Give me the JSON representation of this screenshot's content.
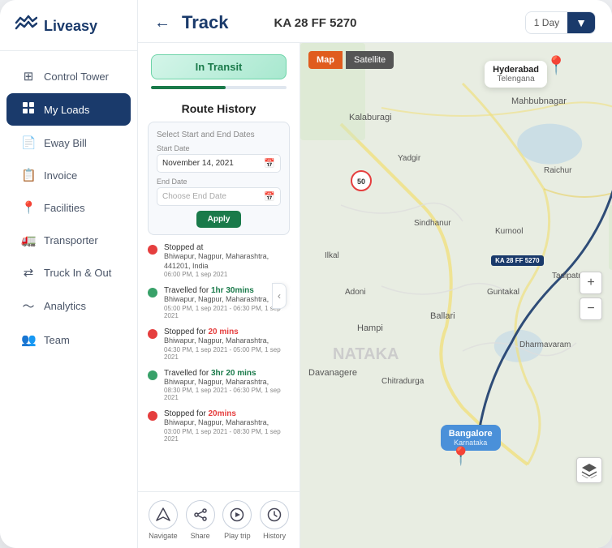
{
  "app": {
    "logo_text": "Liveasy",
    "logo_icon": "⋀⋀"
  },
  "sidebar": {
    "items": [
      {
        "id": "control-tower",
        "label": "Control Tower",
        "icon": "⊞",
        "active": false
      },
      {
        "id": "my-loads",
        "label": "My Loads",
        "icon": "📦",
        "active": true
      },
      {
        "id": "eway-bill",
        "label": "Eway Bill",
        "icon": "📄",
        "active": false
      },
      {
        "id": "invoice",
        "label": "Invoice",
        "icon": "📋",
        "active": false
      },
      {
        "id": "facilities",
        "label": "Facilities",
        "icon": "📍",
        "active": false
      },
      {
        "id": "transporter",
        "label": "Transporter",
        "icon": "🚛",
        "active": false
      },
      {
        "id": "truck-in-out",
        "label": "Truck In & Out",
        "icon": "🔄",
        "active": false
      },
      {
        "id": "analytics",
        "label": "Analytics",
        "icon": "📈",
        "active": false
      },
      {
        "id": "team",
        "label": "Team",
        "icon": "👥",
        "active": false
      }
    ]
  },
  "header": {
    "back_label": "←",
    "title": "Track",
    "vehicle_id": "KA 28 FF 5270",
    "day_selector": {
      "label": "1 Day",
      "dropdown_icon": "▼"
    }
  },
  "transit_badge": "In Transit",
  "progress_percent": 55,
  "route_history": {
    "title": "Route History",
    "date_selector": {
      "section_label": "Select Start and End Dates",
      "start_date_label": "Start Date",
      "start_date_value": "November 14, 2021",
      "end_date_label": "End Date",
      "end_date_placeholder": "Choose End Date",
      "apply_btn": "Apply"
    },
    "events": [
      {
        "type": "stopped",
        "status": "Stopped at",
        "duration": "",
        "location": "Bhiwapur, Nagpur, Maharashtra, 441201, India",
        "time": "06:00 PM, 1 sep 2021",
        "dot_color": "red"
      },
      {
        "type": "travelled",
        "status": "Travelled for",
        "duration": "1hr 30mins",
        "location": "Bhiwapur, Nagpur, Maharashtra,",
        "time": "05:00 PM, 1 sep 2021 - 06:30 PM, 1 sep 2021",
        "dot_color": "green"
      },
      {
        "type": "stopped",
        "status": "Stopped for",
        "duration": "20 mins",
        "location": "Bhiwapur, Nagpur, Maharashtra,",
        "time": "04:30 PM, 1 sep 2021 - 05:00 PM, 1 sep 2021",
        "dot_color": "red"
      },
      {
        "type": "travelled",
        "status": "Travelled for",
        "duration": "3hr 20 mins",
        "location": "Bhiwapur, Nagpur, Maharashtra,",
        "time": "08:30 PM, 1 sep 2021 - 06:30 PM, 1 sep 2021",
        "dot_color": "green"
      },
      {
        "type": "stopped",
        "status": "Stopped for",
        "duration": "20mins",
        "location": "Bhiwapur, Nagpur, Maharashtra,",
        "time": "03:00 PM, 1 sep 2021 - 08:30 PM, 1 sep 2021",
        "dot_color": "red"
      }
    ]
  },
  "bottom_actions": [
    {
      "id": "navigate",
      "icon": "➤",
      "label": "Navigate"
    },
    {
      "id": "share",
      "icon": "↗",
      "label": "Share"
    },
    {
      "id": "play-trip",
      "icon": "⏵",
      "label": "Play trip"
    },
    {
      "id": "history",
      "icon": "🕐",
      "label": "History"
    }
  ],
  "map": {
    "controls": [
      "Map",
      "Satellite"
    ],
    "hyderabad_popup": {
      "city": "Hyderabad",
      "state": "Telengana"
    },
    "bangalore_popup": {
      "city": "Bangalore",
      "state": "Karnataka"
    },
    "vehicle_badge": "KA 28 FF 5270",
    "zoom_in": "+",
    "zoom_out": "−"
  },
  "colors": {
    "primary": "#1a3a6b",
    "green": "#38a169",
    "red": "#e53e3e",
    "transit_green": "#1a7a4a",
    "orange": "#e05c1e",
    "blue_popup": "#4a90d9"
  }
}
